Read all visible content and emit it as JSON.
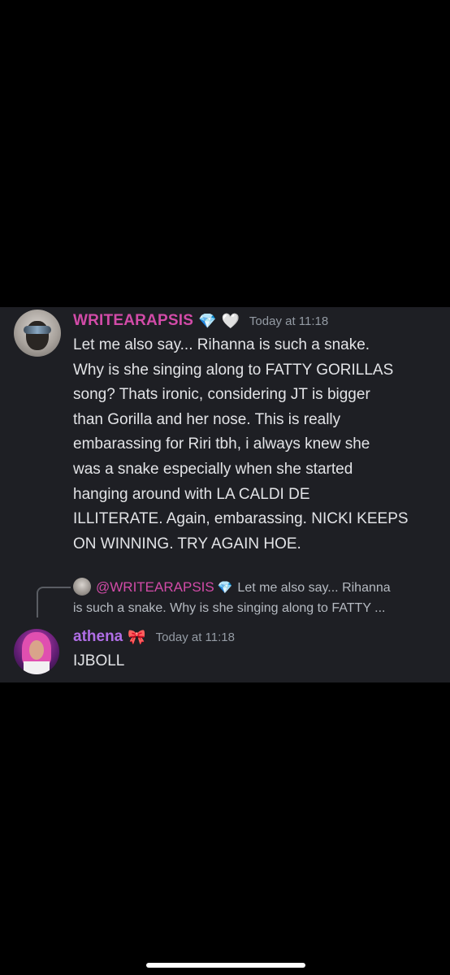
{
  "messages": [
    {
      "author": "WRITEARAPSIS",
      "badges": [
        "💎",
        "🤍"
      ],
      "timestamp": "Today at 11:18",
      "lines": [
        "Let me also say... Rihanna is such a snake.",
        "Why is she singing along to FATTY GORILLAS",
        "song? Thats ironic, considering JT is bigger",
        "than Gorilla and her nose. This is really",
        "embarassing for Riri tbh, i always knew she",
        "was a snake especially when she started",
        "hanging around with LA CALDI DE",
        "ILLITERATE. Again, embarassing. NICKI KEEPS",
        "ON WINNING. TRY AGAIN HOE."
      ]
    },
    {
      "reply": {
        "author": "@WRITEARAPSIS",
        "badge": "💎",
        "preview_line_1": "Let me also say... Rihanna",
        "preview_line_2": "is such a snake. Why is she singing along to FATTY ..."
      },
      "author": "athena",
      "badge": "🎀",
      "timestamp": "Today at 11:18",
      "text": "IJBOLL"
    }
  ],
  "colors": {
    "background": "#000000",
    "chat_background": "#1e1f24",
    "author_1": "#d24ba8",
    "author_2": "#b06ee6",
    "text": "#e2e3e6",
    "muted": "#949ba4"
  }
}
